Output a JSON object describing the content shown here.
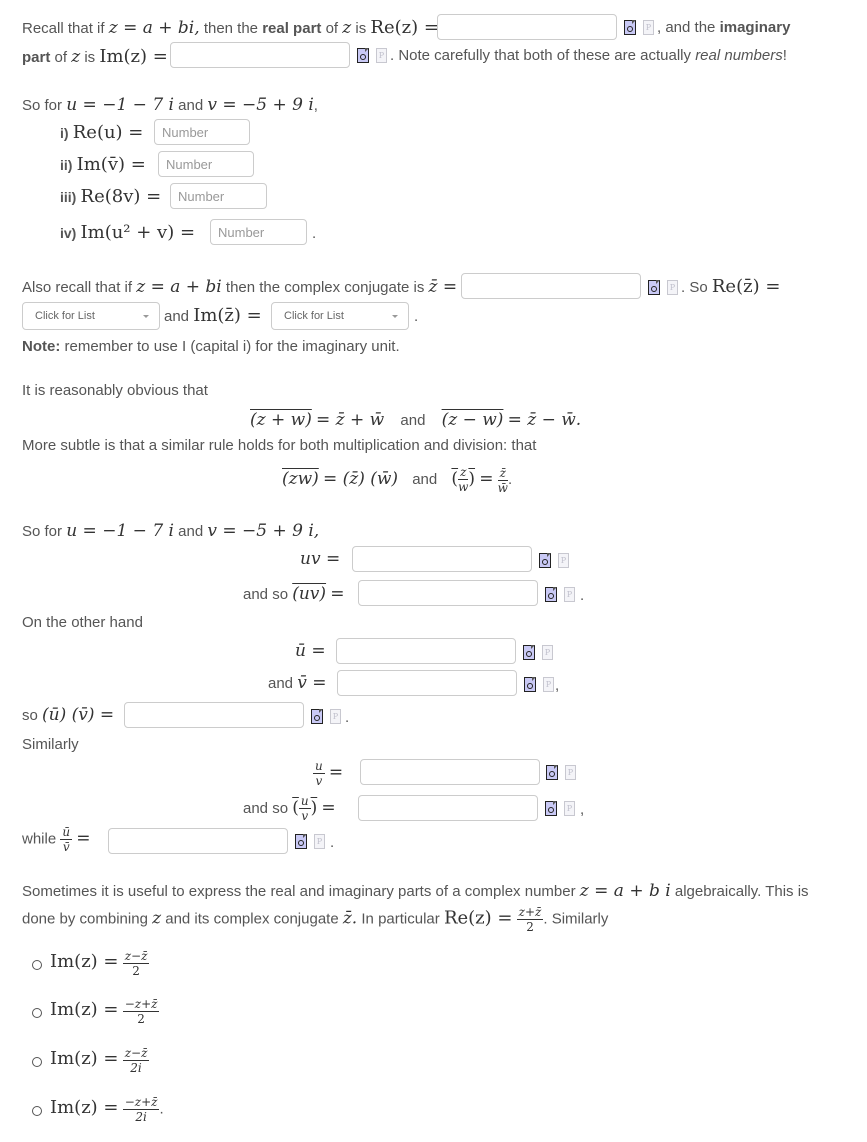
{
  "intro": {
    "line1_a": "Recall that if",
    "z_eq": "z = a + bi,",
    "line1_b": "then the",
    "real_part_bold": "real part",
    "of": "of",
    "z": "z",
    "is": "is",
    "re_z": "Re(z) =",
    "line1_c": ", and the",
    "imag_bold": "imaginary",
    "part_bold": "part",
    "im_z": "Im(z) =",
    "line2_c": ". Note carefully that both of these are actually",
    "real_numbers": "real numbers",
    "excl": "!"
  },
  "section1": {
    "so_for": "So for",
    "u_def": "u = −1 − 7 i",
    "and": "and",
    "v_def": "v = −5 + 9 i",
    "comma": ",",
    "items": [
      {
        "label": "i)",
        "expr": "Re(u) =",
        "placeholder": "Number"
      },
      {
        "label": "ii)",
        "expr": "Im(v̄) =",
        "placeholder": "Number"
      },
      {
        "label": "iii)",
        "expr": "Re(8v) =",
        "placeholder": "Number"
      },
      {
        "label": "iv)",
        "expr": "Im(u² + v) =",
        "placeholder": "Number"
      }
    ],
    "period": "."
  },
  "section2": {
    "text_a": "Also recall that if",
    "z_eq": "z = a + bi",
    "text_b": "then the complex conjugate is",
    "zbar_eq": "z̄ =",
    "so": ". So",
    "re_zbar": "Re(z̄) =",
    "and": "and",
    "im_zbar": "Im(z̄) =",
    "dropdown1": "Click for List",
    "dropdown2": "Click for List",
    "period": ".",
    "note_bold": "Note:",
    "note_text": "remember to use I (capital i) for the imaginary unit."
  },
  "section3": {
    "obvious": "It is reasonably obvious that",
    "eq1_left": "(z + w)",
    "eq1_right": "= z̄ + w̄",
    "and": "and",
    "eq2_left": "(z − w)",
    "eq2_right": "= z̄ − w̄.",
    "subtle": "More subtle is that a similar rule holds for both multiplication and division: that",
    "eq3_left": "(zw)",
    "eq3_right": "= (z̄) (w̄)",
    "eq4_eq": "=",
    "eq4_num": "z̄",
    "eq4_den": "w̄",
    "z": "z",
    "w": "w"
  },
  "section4": {
    "so_for": "So for",
    "u_def": "u = −1 − 7 i",
    "and": "and",
    "v_def": "v = −5 + 9 i,",
    "uv": "uv =",
    "and_so": "and so",
    "uv_bar": "(uv)",
    "eq": "=",
    "period": ".",
    "other_hand": "On the other hand",
    "ubar": "ū =",
    "and_vbar_text": "and",
    "vbar": "v̄ =",
    "comma": ",",
    "so": "so",
    "ubar_vbar": "(ū) (v̄) =",
    "similarly": "Similarly",
    "u": "u",
    "v": "v",
    "while": "while",
    "ubar_s": "ū",
    "vbar_s": "v̄"
  },
  "section5": {
    "text_a": "Sometimes it is useful to express the real and imaginary parts of a complex number",
    "z_eq": "z = a + b i",
    "text_b": "algebraically. This is",
    "text_c": "done by combining",
    "z": "z",
    "text_d": "and its complex conjugate",
    "zbar": "z̄.",
    "text_e": "In particular",
    "re_z": "Re(z) =",
    "re_num": "z+z̄",
    "re_den": "2",
    "similarly": ". Similarly",
    "options": [
      {
        "lhs": "Im(z) =",
        "num": "z−z̄",
        "den": "2",
        "tail": ""
      },
      {
        "lhs": "Im(z) =",
        "num": "−z+z̄",
        "den": "2",
        "tail": ""
      },
      {
        "lhs": "Im(z) =",
        "num": "z−z̄",
        "den": "2i",
        "tail": ""
      },
      {
        "lhs": "Im(z) =",
        "num": "−z+z̄",
        "den": "2i",
        "tail": "."
      }
    ]
  },
  "icons": {
    "preview": "preview-icon",
    "help": "P"
  }
}
